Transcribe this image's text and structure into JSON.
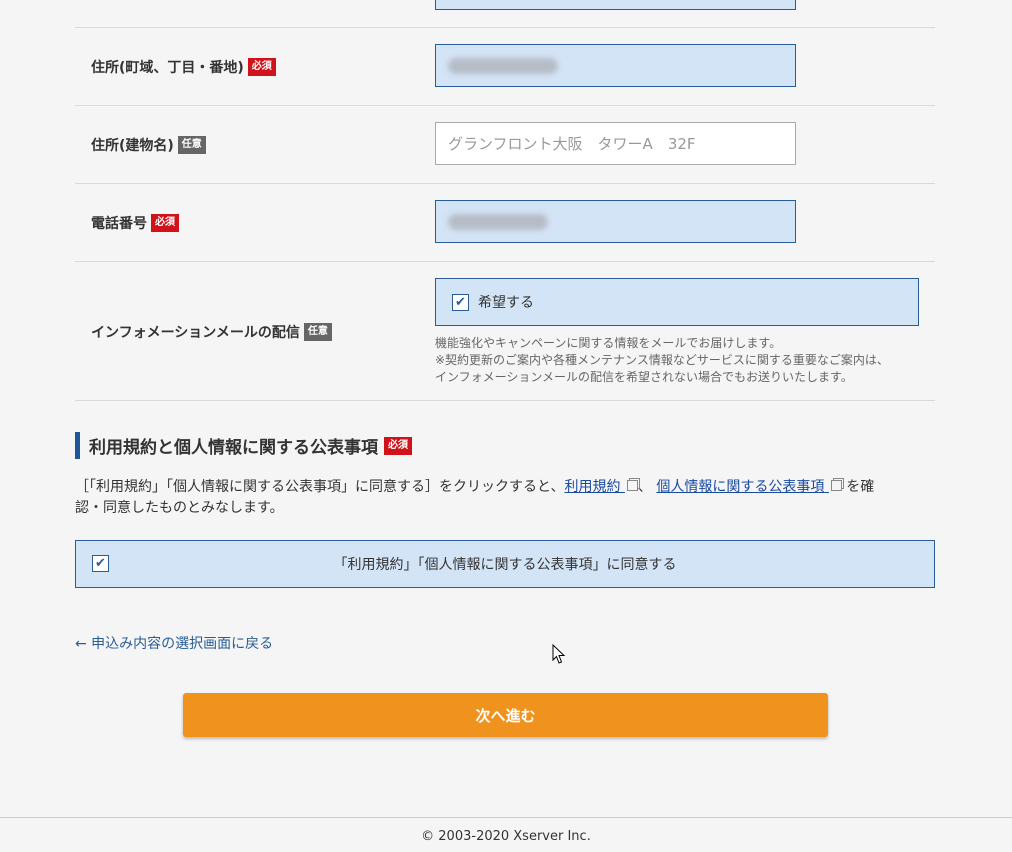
{
  "fields": {
    "address_street": {
      "label": "住所(町域、丁目・番地)",
      "badge": "必須"
    },
    "address_building": {
      "label": "住所(建物名)",
      "badge": "任意",
      "placeholder": "グランフロント大阪　タワーA　32F"
    },
    "phone": {
      "label": "電話番号",
      "badge": "必須"
    },
    "info_mail": {
      "label": "インフォメーションメールの配信",
      "badge": "任意",
      "option_label": "希望する",
      "checked": true,
      "note_lines": [
        "機能強化やキャンペーンに関する情報をメールでお届けします。",
        "※契約更新のご案内や各種メンテナンス情報などサービスに関する重要なご案内は、",
        "インフォメーションメールの配信を希望されない場合でもお送りいたします。"
      ]
    }
  },
  "terms_section": {
    "title": "利用規約と個人情報に関する公表事項",
    "badge": "必須",
    "desc_prefix": "［「利用規約」「個人情報に関する公表事項」に同意する］をクリックすると、",
    "link_terms": "利用規約",
    "separator": "、",
    "link_privacy": "個人情報に関する公表事項",
    "desc_suffix_1": "を確",
    "desc_line2": "認・同意したものとみなします。",
    "agree_label": "「利用規約」「個人情報に関する公表事項」に同意する",
    "agree_checked": true
  },
  "nav": {
    "back_link": "← 申込み内容の選択画面に戻る",
    "next_button": "次へ進む"
  },
  "footer": {
    "copyright": "© 2003-2020 Xserver Inc."
  },
  "colors": {
    "required_badge": "#d0121b",
    "optional_badge": "#666666",
    "filled_input_bg": "#d4e4f7",
    "accent_blue": "#1e5799",
    "next_button": "#f0921e"
  },
  "icons": [
    "checkmark-icon",
    "external-link-icon",
    "mouse-cursor-icon"
  ]
}
